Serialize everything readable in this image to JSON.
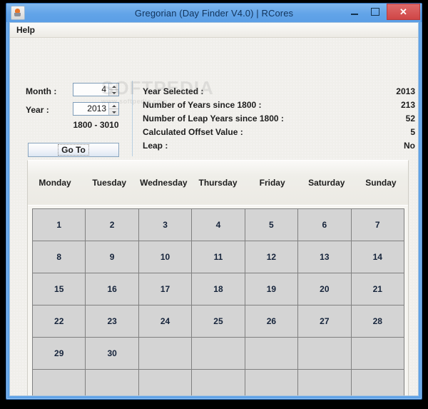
{
  "window": {
    "title": "Gregorian (Day Finder V4.0) | RCores",
    "app_icon": "java-coffee-cup-icon",
    "buttons": {
      "minimize": "minimize-icon",
      "maximize": "maximize-icon",
      "close": "✕"
    },
    "frame_color": "#60a3e8",
    "close_color": "#cf4646"
  },
  "menubar": {
    "items": [
      {
        "label": "Help"
      }
    ]
  },
  "form": {
    "month": {
      "label": "Month :",
      "value": "4"
    },
    "year": {
      "label": "Year :",
      "value": "2013"
    },
    "range_text": "1800 - 3010",
    "goto_label": "Go To"
  },
  "info": {
    "rows": [
      {
        "label": "Year Selected :",
        "value": "2013"
      },
      {
        "label": "Number of Years since 1800 :",
        "value": "213"
      },
      {
        "label": "Number of Leap Years since 1800 :",
        "value": "52"
      },
      {
        "label": "Calculated Offset Value :",
        "value": "5"
      },
      {
        "label": "Leap :",
        "value": "No"
      }
    ]
  },
  "calendar": {
    "day_headers": [
      "Monday",
      "Tuesday",
      "Wednesday",
      "Thursday",
      "Friday",
      "Saturday",
      "Sunday"
    ],
    "weeks": [
      [
        "1",
        "2",
        "3",
        "4",
        "5",
        "6",
        "7"
      ],
      [
        "8",
        "9",
        "10",
        "11",
        "12",
        "13",
        "14"
      ],
      [
        "15",
        "16",
        "17",
        "18",
        "19",
        "20",
        "21"
      ],
      [
        "22",
        "23",
        "24",
        "25",
        "26",
        "27",
        "28"
      ],
      [
        "29",
        "30",
        "",
        "",
        "",
        "",
        ""
      ],
      [
        "",
        "",
        "",
        "",
        "",
        "",
        ""
      ]
    ]
  },
  "watermark": {
    "text": "SOFTPEDIA",
    "sub": "www.softpedia.com"
  }
}
